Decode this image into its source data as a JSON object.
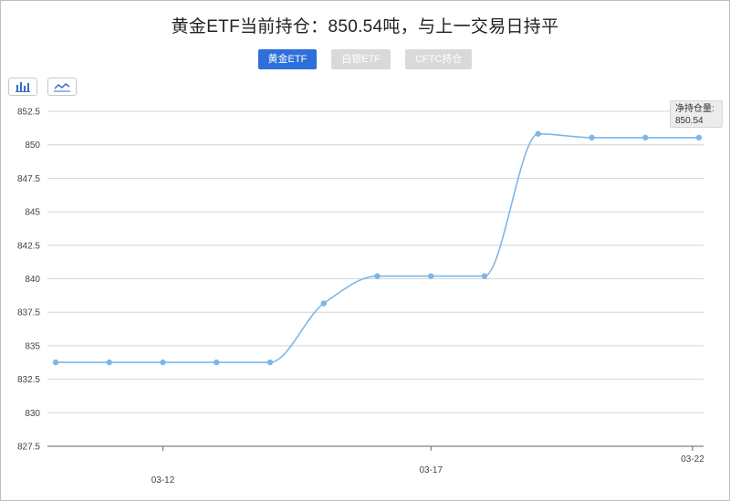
{
  "title": "黄金ETF当前持仓：850.54吨，与上一交易日持平",
  "tabs": [
    {
      "label": "黄金ETF",
      "active": true
    },
    {
      "label": "白银ETF",
      "active": false
    },
    {
      "label": "CFTC持仓",
      "active": false
    }
  ],
  "toolbar": {
    "bar_icon": "bar-chart-icon",
    "line_icon": "line-chart-icon"
  },
  "tooltip": {
    "label": "净持仓量:",
    "value": "850.54"
  },
  "colors": {
    "line": "#7eb6e6",
    "active_tab": "#2f6fdc",
    "inactive_tab": "#d9d9d9"
  },
  "chart_data": {
    "type": "line",
    "x_tick_labels": [
      "03-12",
      "03-17",
      "03-22"
    ],
    "x_tick_indices": [
      2,
      7,
      12
    ],
    "y_ticks": [
      827.5,
      830,
      832.5,
      835,
      837.5,
      840,
      842.5,
      845,
      847.5,
      850,
      852.5
    ],
    "y_tick_labels": [
      "827.5",
      "830",
      "832.5",
      "835",
      "837.5",
      "840",
      "842.5",
      "845",
      "847.5",
      "850",
      "852.5"
    ],
    "ylim": [
      827.5,
      852.5
    ],
    "grid": true,
    "values": [
      833.76,
      833.76,
      833.76,
      833.76,
      833.76,
      838.16,
      840.2,
      840.2,
      840.2,
      850.82,
      850.54,
      850.54,
      850.54
    ]
  }
}
